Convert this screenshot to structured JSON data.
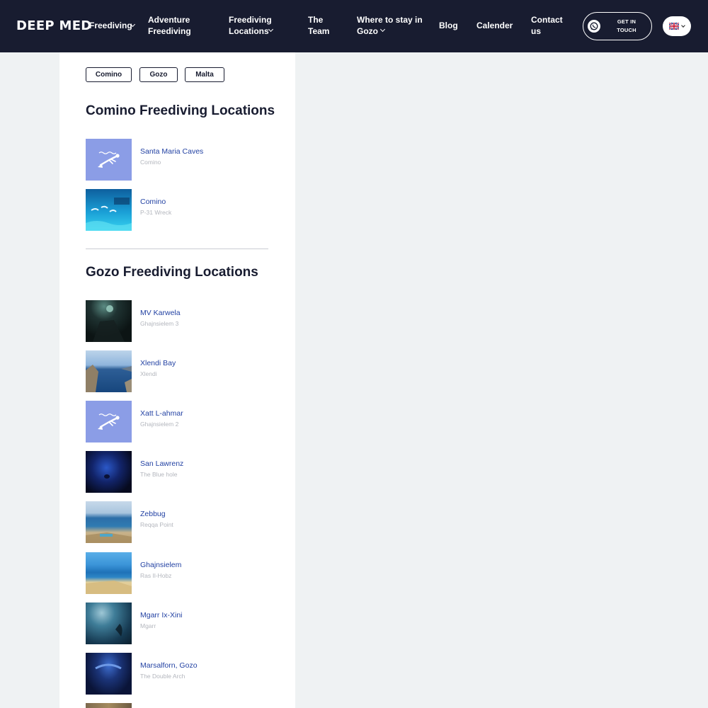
{
  "header": {
    "logo": "DEEP MED",
    "nav": [
      {
        "line1": "Freediving",
        "line2": ""
      },
      {
        "line1": "Adventure",
        "line2": "Freediving"
      },
      {
        "line1": "Freediving",
        "line2": "Locations"
      },
      {
        "line1": "The",
        "line2": "Team"
      },
      {
        "line1": "Where to stay in",
        "line2": "Gozo"
      },
      {
        "line1": "Blog",
        "line2": ""
      },
      {
        "line1": "Calender",
        "line2": ""
      },
      {
        "line1": "Contact",
        "line2": "us"
      }
    ],
    "cta": {
      "line1": "GET IN",
      "line2": "TOUCH",
      "icon": "whatsapp-icon"
    },
    "language": {
      "flag": "uk-flag-icon"
    }
  },
  "filters": [
    "Comino",
    "Gozo",
    "Malta"
  ],
  "sections": [
    {
      "title": "Comino Freediving Locations",
      "locations": [
        {
          "name": "Santa Maria Caves",
          "subtitle": "Comino",
          "thumb": "diver-placeholder-icon"
        },
        {
          "name": "Comino",
          "subtitle": "P-31 Wreck",
          "thumb": "underwater-divers-photo"
        }
      ]
    },
    {
      "title": "Gozo Freediving Locations",
      "locations": [
        {
          "name": "MV Karwela",
          "subtitle": "Ghajnsielem 3",
          "thumb": "dark-wreck-photo"
        },
        {
          "name": "Xlendi Bay",
          "subtitle": "Xlendi",
          "thumb": "bay-cliffs-photo"
        },
        {
          "name": "Xatt L-ahmar",
          "subtitle": "Ghajnsielem 2",
          "thumb": "diver-placeholder-icon"
        },
        {
          "name": "San Lawrenz",
          "subtitle": "The Blue hole",
          "thumb": "blue-hole-photo"
        },
        {
          "name": "Zebbug",
          "subtitle": "Reqqa Point",
          "thumb": "coastline-photo"
        },
        {
          "name": "Ghajnsielem",
          "subtitle": "Ras Il-Hobz",
          "thumb": "rocky-shore-photo"
        },
        {
          "name": "Mgarr Ix-Xini",
          "subtitle": "Mgarr",
          "thumb": "underwater-cave-photo"
        },
        {
          "name": "Marsalforn, Gozo",
          "subtitle": "The Double Arch",
          "thumb": "double-arch-photo"
        },
        {
          "name": "",
          "subtitle": "",
          "thumb": "rock-photo"
        }
      ]
    }
  ],
  "colors": {
    "header_bg": "#181c30",
    "link": "#2342a3",
    "subtitle": "#b3b6bd",
    "placeholder_bg": "#8b9de6"
  }
}
